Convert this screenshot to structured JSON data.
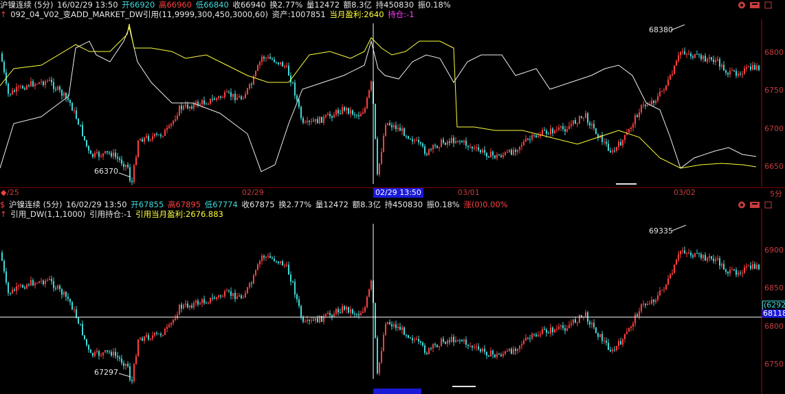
{
  "top": {
    "header": {
      "symbol": "沪镍连续 (5分)",
      "datetime": "16/02/29 13:50",
      "open": "开66920",
      "high": "高66960",
      "low": "低66840",
      "close": "收66940",
      "turnover_rate": "换2.77%",
      "volume": "量12472",
      "amount": "额8.3亿",
      "position": "持450830",
      "amplitude": "振0.18%"
    },
    "indicator": {
      "name": "092_04_V02_变ADD_MARKET_DW引用(11,9999,300,450,3000,60)",
      "assets": "资产:1007851",
      "month_profit": "当月盈利:2640",
      "holding": "持仓:-1"
    },
    "annotations": {
      "high": "68380",
      "low": "66370"
    },
    "yaxis": [
      "6800",
      "6750",
      "6700",
      "6650"
    ]
  },
  "axis": {
    "left_label": "/25",
    "labels": [
      "02/29",
      "03/01",
      "03/02"
    ],
    "cursor": "02/29 13:50",
    "period": "5分"
  },
  "bottom": {
    "header": {
      "symbol": "沪镍连续 (5分)",
      "datetime": "16/02/29 13:50",
      "open": "开67855",
      "high": "高67895",
      "low": "低67774",
      "close": "收67875",
      "turnover_rate": "换2.77%",
      "volume": "量12472",
      "amount": "额8.3亿",
      "position": "持450830",
      "amplitude": "振0.18%",
      "change": "涨(0)0.00%"
    },
    "indicator": {
      "name": "引用_DW(1,1,1000)",
      "holding": "引用持仓:-1",
      "month_profit": "引用当月盈利:2676.883"
    },
    "annotations": {
      "high": "69335",
      "low": "67297"
    },
    "yaxis": [
      "6900",
      "6850",
      "6800",
      "6750"
    ],
    "crosshair_value_1": "(6292",
    "crosshair_value_2": "68118"
  },
  "colors": {
    "up": "#ff4040",
    "down": "#41d9d9",
    "yellow": "#ffff3c",
    "magenta": "#ff40ff",
    "frame": "#b40000"
  }
}
